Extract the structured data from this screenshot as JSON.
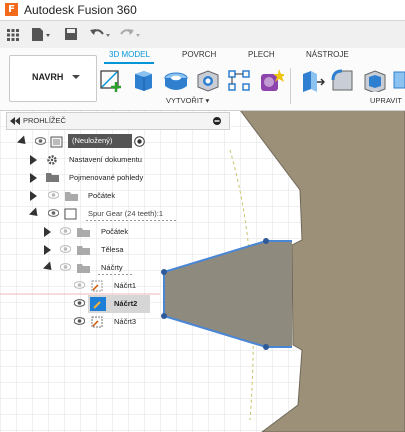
{
  "app": {
    "logo_letter": "F",
    "title": "Autodesk Fusion 360"
  },
  "ribbon": {
    "tabs": [
      "3D MODEL",
      "POVRCH",
      "PLECH",
      "NÁSTROJE"
    ],
    "active_tab": "3D MODEL",
    "workspace": "NAVRH",
    "group_create": "VYTVOŘIT",
    "group_modify": "UPRAVIT",
    "accent": "#0696d7"
  },
  "browser": {
    "title": "PROHLÍŽEČ",
    "items": [
      {
        "label": "(Neuložený)"
      },
      {
        "label": "Nastavení dokumentu"
      },
      {
        "label": "Pojmenované pohledy"
      },
      {
        "label": "Počátek"
      },
      {
        "label": "Spur Gear (24 teeth):1"
      },
      {
        "label": "Počátek"
      },
      {
        "label": "Tělesa"
      },
      {
        "label": "Náčrty"
      },
      {
        "label": "Náčrt1"
      },
      {
        "label": "Náčrt2"
      },
      {
        "label": "Náčrt3"
      }
    ]
  },
  "colors": {
    "gear_face": "#9c9079",
    "profile_stroke": "#4a86d6",
    "selected_icon": "#1e7fd6"
  }
}
